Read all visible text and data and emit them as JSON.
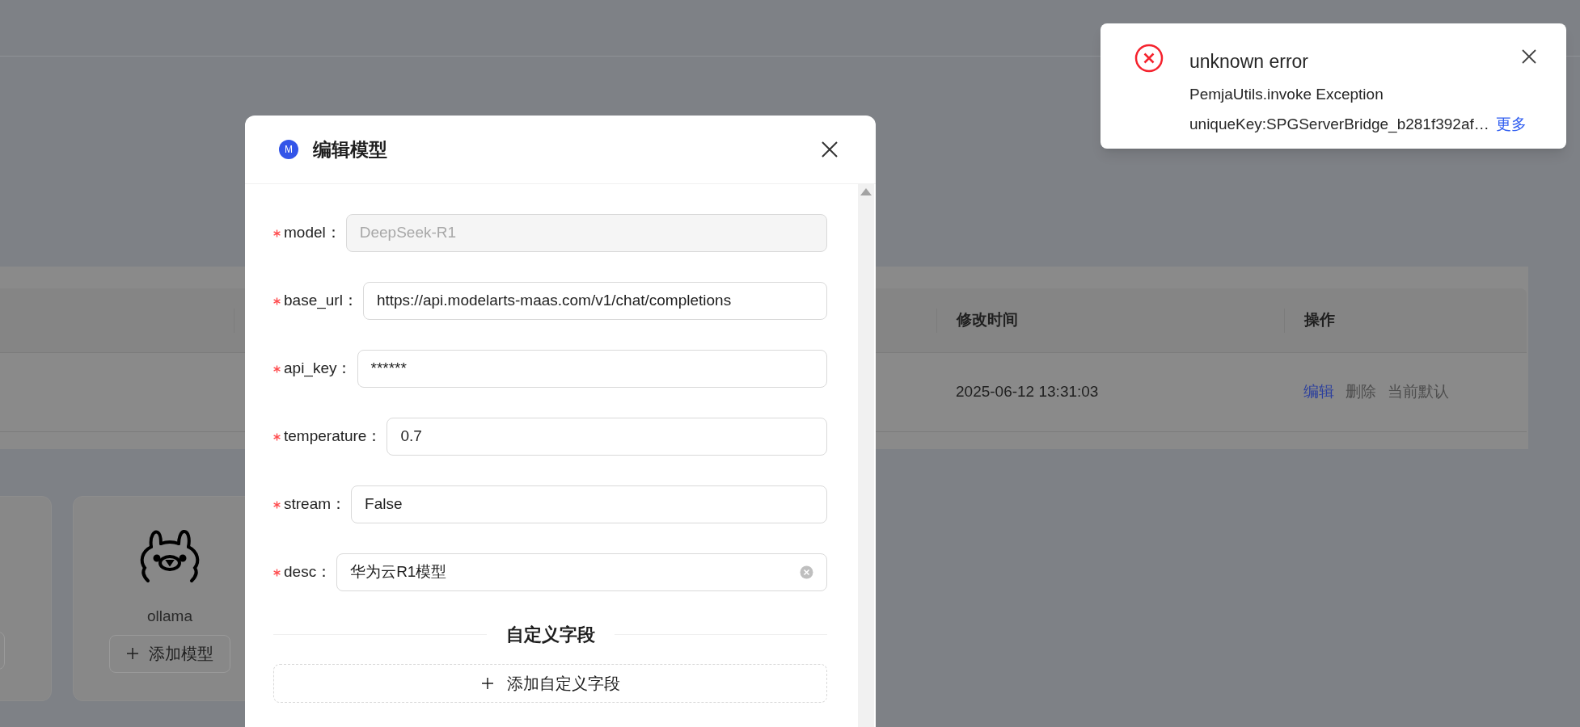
{
  "table": {
    "columns": [
      {
        "label": "修改时间"
      },
      {
        "label": "操作"
      }
    ],
    "rows": [
      {
        "modified": "2025-06-12 13:31:03",
        "actions": [
          {
            "label": "编辑",
            "disabled": false
          },
          {
            "label": "删除",
            "disabled": true
          },
          {
            "label": "当前默认",
            "disabled": true
          }
        ]
      }
    ]
  },
  "cards": [
    {
      "name": "ollama",
      "button": "添加模型"
    }
  ],
  "modal": {
    "avatar": "M",
    "title": "编辑模型",
    "fields": [
      {
        "label": "model：",
        "value": "DeepSeek-R1",
        "required": true,
        "disabled": true,
        "clearable": false
      },
      {
        "label": "base_url：",
        "value": "https://api.modelarts-maas.com/v1/chat/completions",
        "required": true,
        "disabled": false,
        "clearable": false
      },
      {
        "label": "api_key：",
        "value": "******",
        "required": true,
        "disabled": false,
        "clearable": false
      },
      {
        "label": "temperature：",
        "value": "0.7",
        "required": true,
        "disabled": false,
        "clearable": false
      },
      {
        "label": "stream：",
        "value": "False",
        "required": true,
        "disabled": false,
        "clearable": false
      },
      {
        "label": "desc：",
        "value": "华为云R1模型",
        "required": true,
        "disabled": false,
        "clearable": true
      }
    ],
    "section": "自定义字段",
    "add_button": "添加自定义字段"
  },
  "notification": {
    "title": "unknown error",
    "lines": [
      "PemjaUtils.invoke Exception",
      "uniqueKey:SPGServerBridge_b281f392af…"
    ],
    "link": "更多"
  }
}
